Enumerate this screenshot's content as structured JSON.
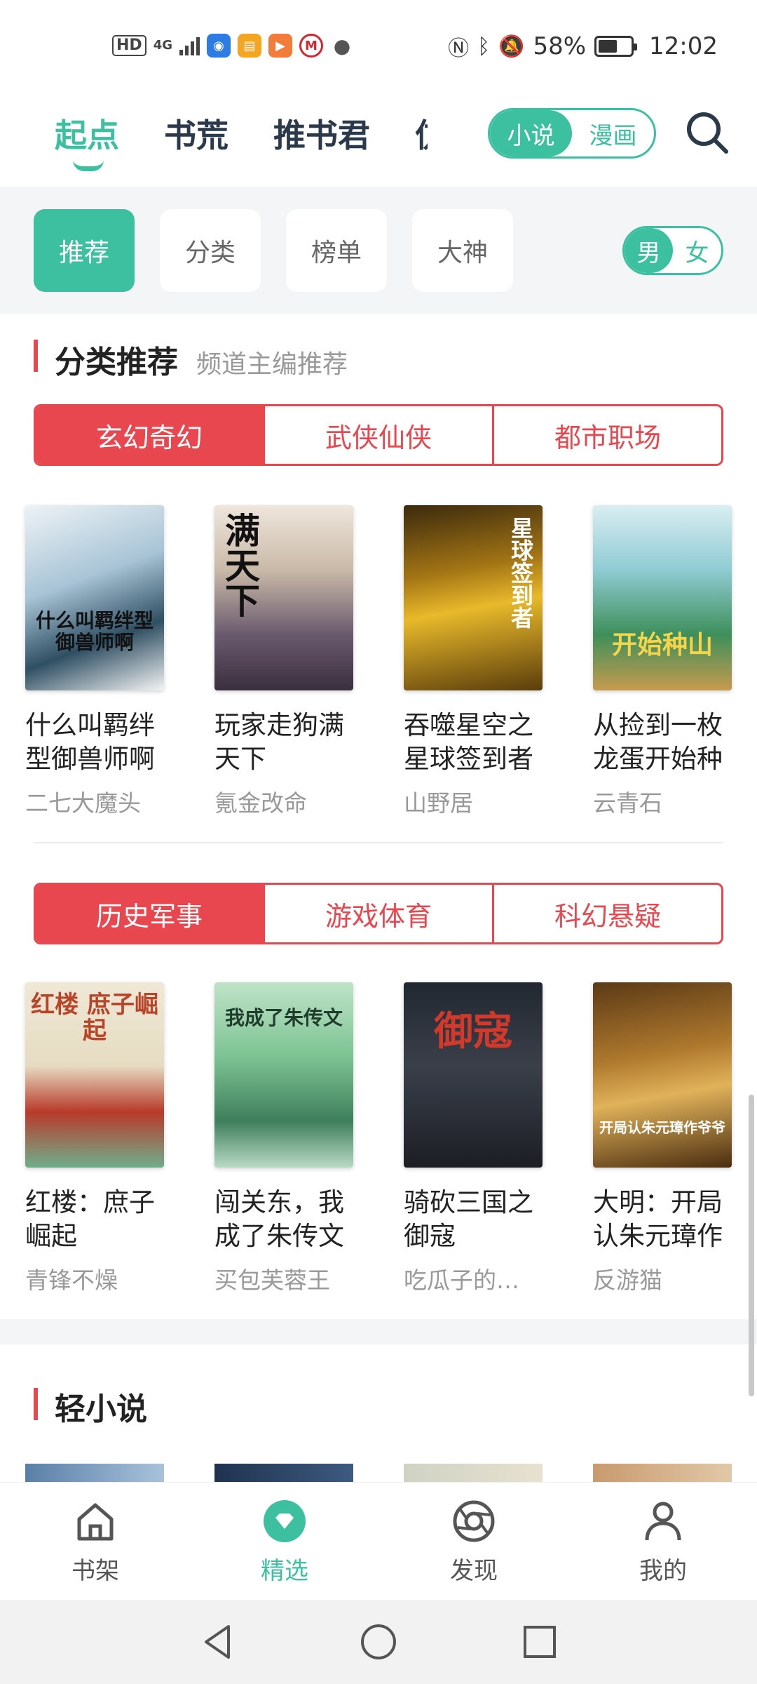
{
  "status_bar": {
    "hd": "HD",
    "network": "4G",
    "battery_text": "58%",
    "battery_level": 0.58,
    "time": "12:02"
  },
  "top_nav": {
    "tabs": [
      "起点",
      "书荒",
      "推书君",
      "仿"
    ],
    "active_tab": "起点",
    "mode_toggle": {
      "novel": "小说",
      "comic": "漫画",
      "selected": "小说"
    }
  },
  "filter": {
    "chips": [
      "推荐",
      "分类",
      "榜单",
      "大神"
    ],
    "active_chip": "推荐",
    "gender": {
      "male": "男",
      "female": "女",
      "selected": "男"
    }
  },
  "section_category": {
    "title": "分类推荐",
    "subtitle": "频道主编推荐",
    "group1": {
      "tabs": [
        "玄幻奇幻",
        "武侠仙侠",
        "都市职场"
      ],
      "active": "玄幻奇幻",
      "books": [
        {
          "title": "什么叫羁绊型御兽师啊",
          "author": "二七大魔头",
          "cover_text": "什么叫羁绊型 御兽师啊"
        },
        {
          "title": "玩家走狗满天下",
          "author": "氪金改命",
          "cover_text": "满天下"
        },
        {
          "title": "吞噬星空之星球签到者",
          "author": "山野居",
          "cover_text": "星球签到者"
        },
        {
          "title": "从捡到一枚龙蛋开始种",
          "author": "云青石",
          "cover_text": "开始种山"
        }
      ]
    },
    "group2": {
      "tabs": [
        "历史军事",
        "游戏体育",
        "科幻悬疑"
      ],
      "active": "历史军事",
      "books": [
        {
          "title": "红楼：庶子崛起",
          "author": "青锋不燥",
          "cover_text": "红楼 庶子崛起"
        },
        {
          "title": "闯关东，我成了朱传文",
          "author": "买包芙蓉王",
          "cover_text": "我成了朱传文"
        },
        {
          "title": "骑砍三国之御寇",
          "author": "吃瓜子的…",
          "cover_text": "御寇"
        },
        {
          "title": "大明：开局认朱元璋作",
          "author": "反游猫",
          "cover_text": "开局认朱元璋作爷爷"
        }
      ]
    }
  },
  "section_light": {
    "title": "轻小说"
  },
  "bottom_nav": {
    "items": [
      "书架",
      "精选",
      "发现",
      "我的"
    ],
    "active": "精选"
  },
  "colors": {
    "accent": "#3cc0a0",
    "red": "#e8474f"
  }
}
